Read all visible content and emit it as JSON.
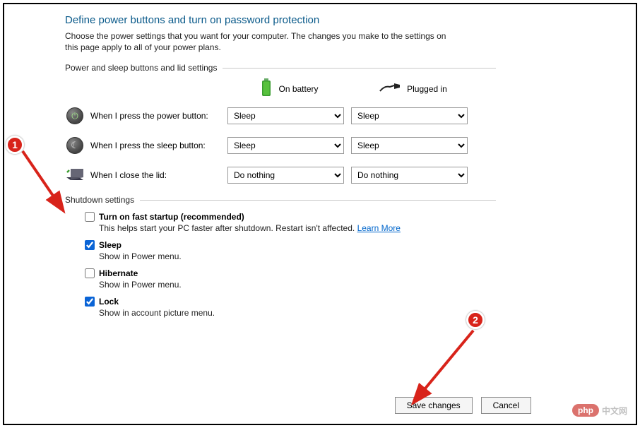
{
  "header": {
    "title": "Define power buttons and turn on password protection",
    "subtitle": "Choose the power settings that you want for your computer. The changes you make to the settings on this page apply to all of your power plans."
  },
  "section1": {
    "legend": "Power and sleep buttons and lid settings",
    "col_battery": "On battery",
    "col_plugged": "Plugged in",
    "rows": [
      {
        "label": "When I press the power button:",
        "battery": "Sleep",
        "plugged": "Sleep"
      },
      {
        "label": "When I press the sleep button:",
        "battery": "Sleep",
        "plugged": "Sleep"
      },
      {
        "label": "When I close the lid:",
        "battery": "Do nothing",
        "plugged": "Do nothing"
      }
    ]
  },
  "section2": {
    "legend": "Shutdown settings",
    "options": [
      {
        "checked": false,
        "label": "Turn on fast startup (recommended)",
        "desc": "This helps start your PC faster after shutdown. Restart isn't affected. ",
        "link": "Learn More"
      },
      {
        "checked": true,
        "label": "Sleep",
        "desc": "Show in Power menu."
      },
      {
        "checked": false,
        "label": "Hibernate",
        "desc": "Show in Power menu."
      },
      {
        "checked": true,
        "label": "Lock",
        "desc": "Show in account picture menu."
      }
    ]
  },
  "footer": {
    "save": "Save changes",
    "cancel": "Cancel"
  },
  "annotations": {
    "badge1": "1",
    "badge2": "2"
  },
  "watermark": {
    "pill": "php",
    "cn": "中文网"
  }
}
